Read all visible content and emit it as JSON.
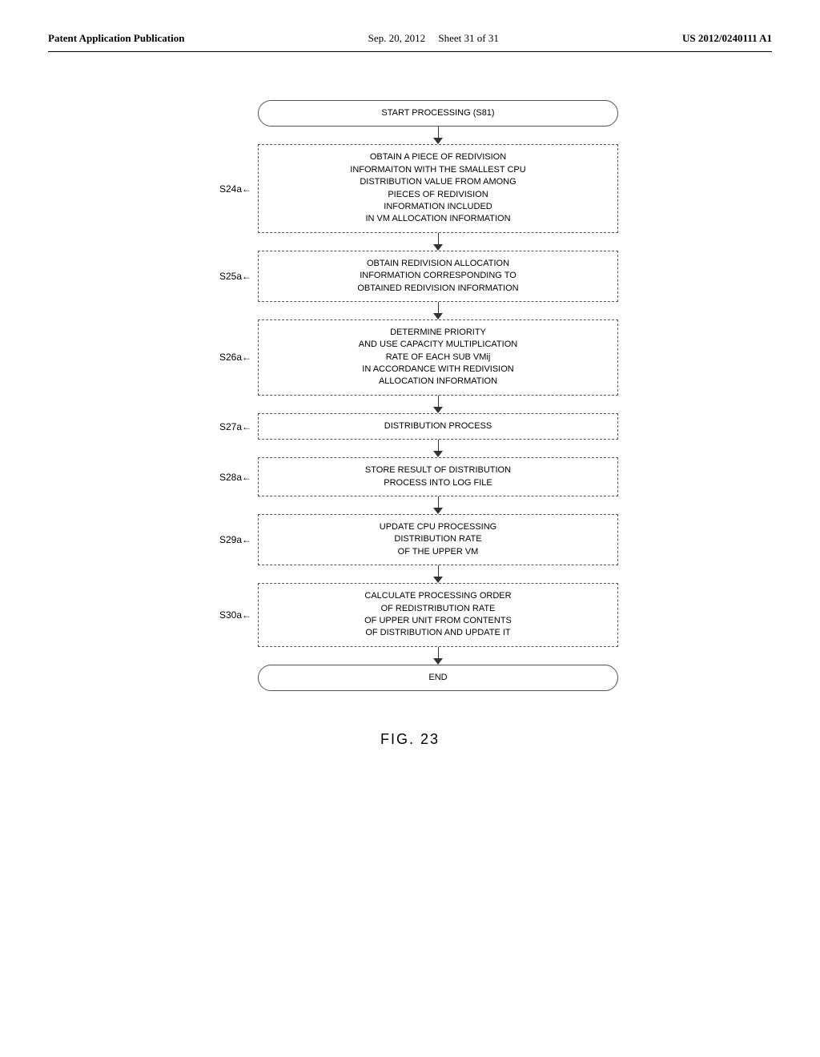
{
  "header": {
    "left": "Patent Application Publication",
    "center_date": "Sep. 20, 2012",
    "center_sheet": "Sheet 31 of 31",
    "right": "US 2012/0240111 A1"
  },
  "diagram": {
    "start_label": "START PROCESSING (S81)",
    "steps": [
      {
        "id": "S24a",
        "label": "S24a",
        "text": "OBTAIN A PIECE OF REDIVISION\nINFORMAITON WITH THE SMALLEST CPU\nDISTRIBUTION VALUE FROM AMONG\nPIECES OF REDIVISION\nINFORMATION INCLUDED\nIN VM ALLOCATION INFORMATION",
        "style": "dashed"
      },
      {
        "id": "S25a",
        "label": "S25a",
        "text": "OBTAIN REDIVISION ALLOCATION\nINFORMATION CORRESPONDING TO\nOBTAINED REDIVISION INFORMATION",
        "style": "dashed"
      },
      {
        "id": "S26a",
        "label": "S26a",
        "text": "DETERMINE PRIORITY\nAND USE CAPACITY MULTIPLICATION\nRATE OF EACH SUB VMij\nIN ACCORDANCE WITH REDIVISION\nALLOCATION INFORMATION",
        "style": "dashed"
      },
      {
        "id": "S27a",
        "label": "S27a",
        "text": "DISTRIBUTION PROCESS",
        "style": "dashed"
      },
      {
        "id": "S28a",
        "label": "S28a",
        "text": "STORE RESULT OF DISTRIBUTION\nPROCESS INTO LOG FILE",
        "style": "dashed"
      },
      {
        "id": "S29a",
        "label": "S29a",
        "text": "UPDATE CPU PROCESSING\nDISTRIBUTION RATE\nOF THE UPPER VM",
        "style": "dashed"
      },
      {
        "id": "S30a",
        "label": "S30a",
        "text": "CALCULATE PROCESSING ORDER\nOF REDISTRIBUTION RATE\nOF UPPER UNIT FROM CONTENTS\nOF DISTRIBUTION AND UPDATE IT",
        "style": "dashed"
      }
    ],
    "end_label": "END",
    "figure_caption": "FIG. 23"
  }
}
